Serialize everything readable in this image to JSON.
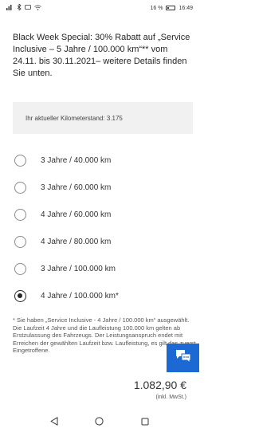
{
  "status_bar": {
    "battery": "16 %",
    "time": "16:49",
    "icons": [
      "signal-icon",
      "bluetooth-icon",
      "message-icon",
      "wifi-icon",
      "battery-icon"
    ]
  },
  "promo": {
    "text": "Black Week Special: 30% Rabatt auf „Service Inclusive – 5 Jahre / 100.000 km“** vom 24.11. bis 30.11.2021– weitere Details finden Sie unten."
  },
  "mileage": {
    "text": "Ihr aktueller Kilometerstand: 3.175"
  },
  "options": [
    {
      "label": "3 Jahre / 40.000 km",
      "selected": false
    },
    {
      "label": "3 Jahre / 60.000 km",
      "selected": false
    },
    {
      "label": "4 Jahre / 60.000 km",
      "selected": false
    },
    {
      "label": "4 Jahre / 80.000 km",
      "selected": false
    },
    {
      "label": "3 Jahre / 100.000 km",
      "selected": false
    },
    {
      "label": "4 Jahre / 100.000 km*",
      "selected": true
    }
  ],
  "footnote": {
    "text": "* Sie haben „Service Inclusive - 4 Jahre / 100.000 km“ ausgewählt. Die Laufzeit 4 Jahre und die Laufleistung 100.000 km gelten ab Erstzulassung des Fahrzeugs. Der Leistungsanspruch endet mit Erreichen der gewählten Laufzeit bzw. Laufleistung, es gilt das zuerst Eingetroffene."
  },
  "price": {
    "amount": "1.082,90 €",
    "note": "(inkl. MwSt.)"
  },
  "colors": {
    "chat_button": "#1c69d4",
    "info_box": "#f1f1f1",
    "text": "#262626"
  },
  "nav": {
    "icons": [
      "back-icon",
      "home-icon",
      "recents-icon"
    ]
  }
}
